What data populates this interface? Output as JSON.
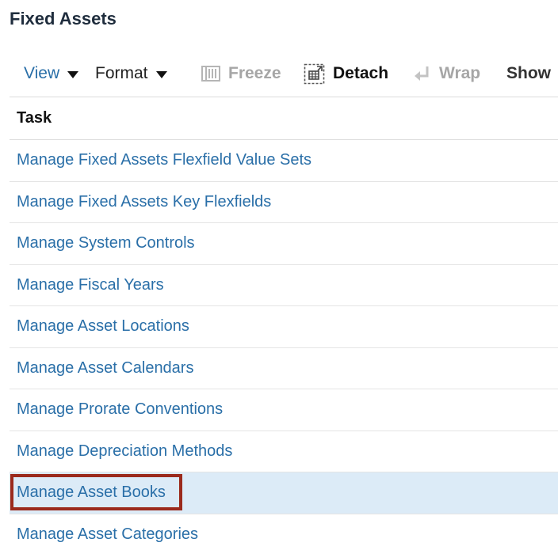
{
  "page": {
    "title": "Fixed Assets"
  },
  "toolbar": {
    "view_label": "View",
    "format_label": "Format",
    "freeze_label": "Freeze",
    "detach_label": "Detach",
    "wrap_label": "Wrap",
    "show_label": "Show",
    "icons": {
      "view": "caret-down-icon",
      "format": "caret-down-icon",
      "freeze": "freeze-columns-icon",
      "detach": "detach-icon",
      "wrap": "wrap-icon"
    },
    "colors": {
      "link": "#2a6fa8",
      "disabled": "#a6a6a6"
    }
  },
  "table": {
    "column_header": "Task",
    "selected_index": 8,
    "selected_color": "#dcebf7",
    "highlight_color": "#9b2a1c",
    "rows": [
      {
        "label": "Manage Fixed Assets Flexfield Value Sets"
      },
      {
        "label": "Manage Fixed Assets Key Flexfields"
      },
      {
        "label": "Manage System Controls"
      },
      {
        "label": "Manage Fiscal Years"
      },
      {
        "label": "Manage Asset Locations"
      },
      {
        "label": "Manage Asset Calendars"
      },
      {
        "label": "Manage Prorate Conventions"
      },
      {
        "label": "Manage Depreciation Methods"
      },
      {
        "label": "Manage Asset Books"
      },
      {
        "label": "Manage Asset Categories"
      }
    ]
  }
}
